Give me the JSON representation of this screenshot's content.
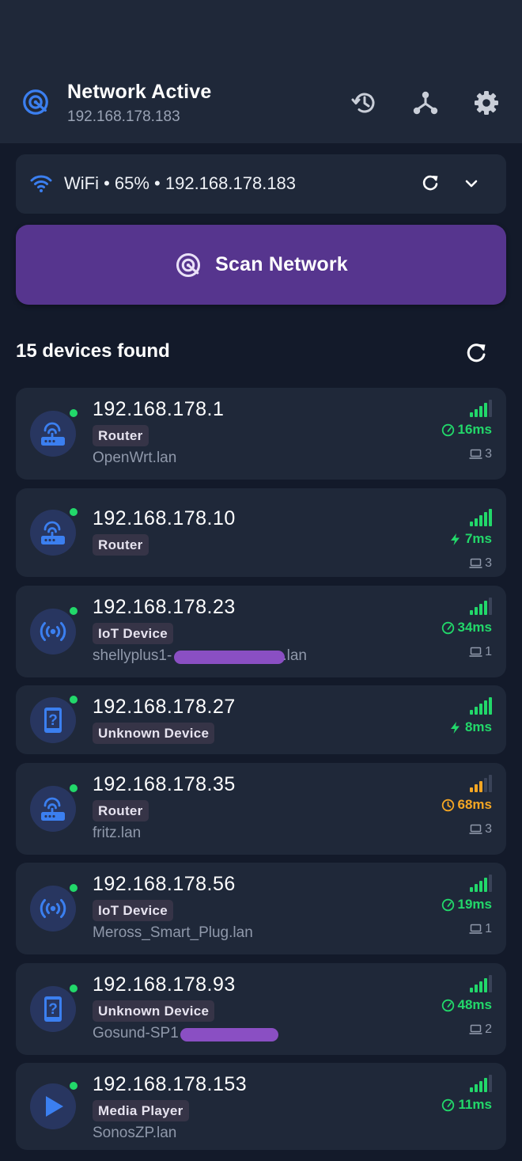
{
  "header": {
    "title": "Network Active",
    "subtitle": "192.168.178.183",
    "logo_icon": "radar-icon",
    "actions": [
      "history-icon",
      "topology-icon",
      "gear-icon"
    ]
  },
  "wifi": {
    "summary": "WiFi • 65% • 192.168.178.183",
    "icon": "wifi-icon"
  },
  "scan": {
    "label": "Scan Network",
    "icon": "radar-icon"
  },
  "devices": {
    "count_label": "15 devices found",
    "items": [
      {
        "ip": "192.168.178.1",
        "type": "Router",
        "host": "OpenWrt.lan",
        "latency": "16ms",
        "speed": "gauge",
        "signal": 4,
        "signal_color": "#22d86a",
        "ports": "3"
      },
      {
        "ip": "192.168.178.10",
        "type": "Router",
        "host": "",
        "latency": "7ms",
        "speed": "bolt",
        "signal": 5,
        "signal_color": "#22d86a",
        "ports": "3"
      },
      {
        "ip": "192.168.178.23",
        "type": "IoT Device",
        "host": "shellyplus1-",
        "host_suffix": ".lan",
        "latency": "34ms",
        "speed": "gauge",
        "signal": 4,
        "signal_color": "#22d86a",
        "ports": "1"
      },
      {
        "ip": "192.168.178.27",
        "type": "Unknown Device",
        "host": "",
        "latency": "8ms",
        "speed": "bolt",
        "signal": 5,
        "signal_color": "#22d86a",
        "ports": ""
      },
      {
        "ip": "192.168.178.35",
        "type": "Router",
        "host": "fritz.lan",
        "latency": "68ms",
        "speed": "clock",
        "signal": 3,
        "signal_color": "#f5a623",
        "ports": "3"
      },
      {
        "ip": "192.168.178.56",
        "type": "IoT Device",
        "host": "Meross_Smart_Plug.lan",
        "latency": "19ms",
        "speed": "gauge",
        "signal": 4,
        "signal_color": "#22d86a",
        "ports": "1"
      },
      {
        "ip": "192.168.178.93",
        "type": "Unknown Device",
        "host": "Gosund-SP1",
        "latency": "48ms",
        "speed": "gauge",
        "signal": 4,
        "signal_color": "#22d86a",
        "ports": "2"
      },
      {
        "ip": "192.168.178.153",
        "type": "Media Player",
        "host": "SonosZP.lan",
        "latency": "11ms",
        "speed": "gauge",
        "signal": 4,
        "signal_color": "#22d86a",
        "ports": ""
      }
    ]
  },
  "colors": {
    "accent": "#56358e",
    "good": "#22d86a",
    "warn": "#f5a623",
    "icon_blue": "#3b7ff0"
  }
}
